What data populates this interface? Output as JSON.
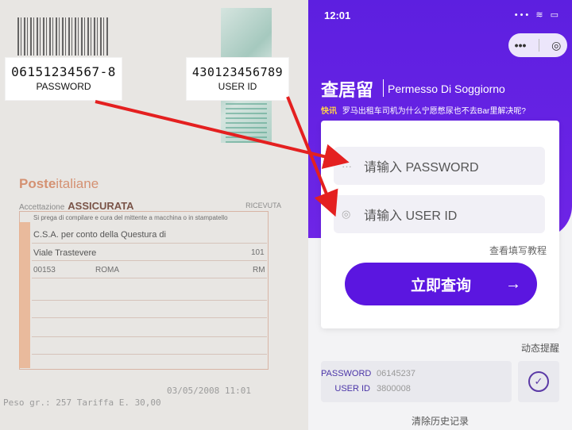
{
  "callouts": {
    "password": {
      "value": "06151234567-8",
      "label": "PASSWORD"
    },
    "user_id": {
      "value": "430123456789",
      "label": "USER ID"
    }
  },
  "receipt": {
    "brand_bold": "Poste",
    "brand_rest": "italiane",
    "header_left": "Accettazione",
    "header_title": "ASSICURATA",
    "header_right": "RICEVUTA",
    "lines": [
      "Si prega di compilare e cura del mittente a macchina o in stampatello",
      "C.S.A. per conto della Questura di",
      "Viale Trastevere",
      "00153",
      "ROMA",
      "RM",
      "101"
    ],
    "footer_1": "03/05/2008 11:01",
    "footer_2": "Peso gr.: 257   Tariffa E. 30,00"
  },
  "phone": {
    "status_time": "12:01",
    "status_icons": "••• ≋ ▭",
    "capsule_dots": "•••",
    "capsule_target": "◎",
    "title_zh": "查居留",
    "title_it": "Permesso Di Soggiorno",
    "news_tag": "快讯",
    "news_text": "罗马出租车司机为什么宁愿憋尿也不去Bar里解决呢?",
    "password_placeholder": "请输入 PASSWORD",
    "userid_placeholder": "请输入 USER ID",
    "password_icon": "···",
    "userid_icon": "◎",
    "tutorial_link": "查看填写教程",
    "query_button": "立即查询",
    "query_arrow": "→",
    "dynamic_reminder": "动态提醒",
    "history": {
      "password_label": "PASSWORD",
      "password_value": "06145237",
      "userid_label": "USER ID",
      "userid_value": "3800008"
    },
    "clear_history": "清除历史记录"
  },
  "colors": {
    "brand_purple": "#5b16e0",
    "arrow_red": "#e42020",
    "news_tag": "#ffd24a"
  }
}
